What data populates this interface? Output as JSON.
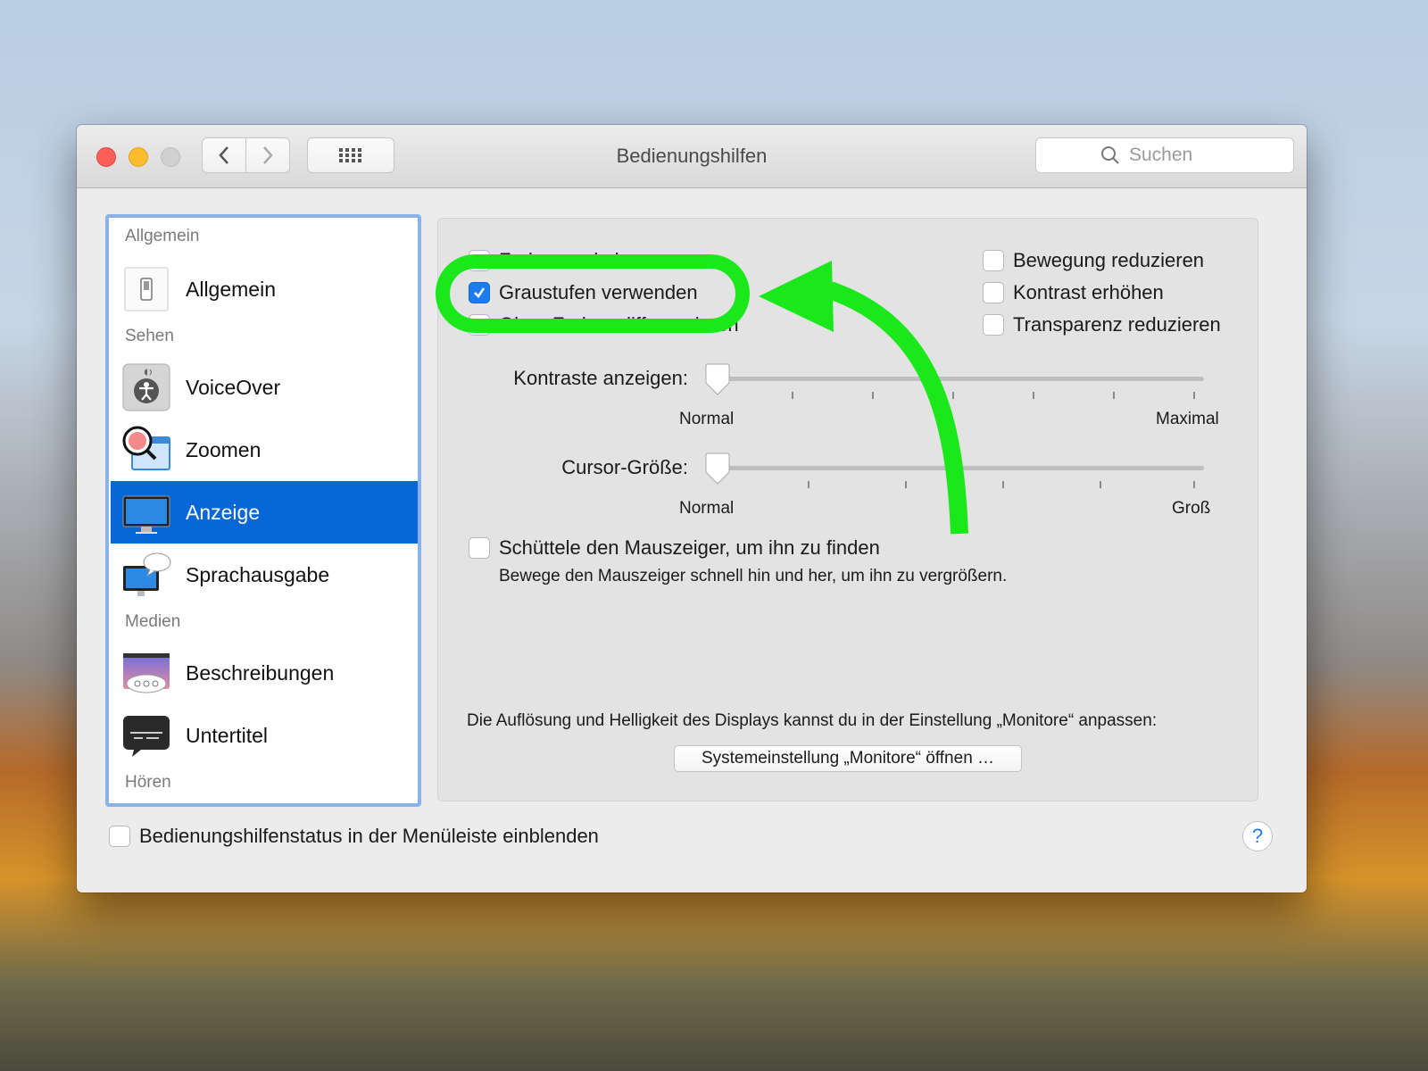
{
  "window": {
    "title": "Bedienungshilfen",
    "search_placeholder": "Suchen"
  },
  "sidebar": {
    "sections": [
      {
        "heading": "Allgemein",
        "items": [
          {
            "label": "Allgemein",
            "icon": "switch-icon"
          }
        ]
      },
      {
        "heading": "Sehen",
        "items": [
          {
            "label": "VoiceOver",
            "icon": "voiceover-icon"
          },
          {
            "label": "Zoomen",
            "icon": "zoom-icon"
          },
          {
            "label": "Anzeige",
            "icon": "display-icon",
            "selected": true
          },
          {
            "label": "Sprachausgabe",
            "icon": "speech-icon"
          }
        ]
      },
      {
        "heading": "Medien",
        "items": [
          {
            "label": "Beschreibungen",
            "icon": "descriptions-icon"
          },
          {
            "label": "Untertitel",
            "icon": "captions-icon"
          }
        ]
      },
      {
        "heading": "Hören",
        "items": []
      }
    ]
  },
  "display": {
    "options_left": [
      {
        "label": "Farben umkehren",
        "checked": false
      },
      {
        "label": "Graustufen verwenden",
        "checked": true
      },
      {
        "label": "Ohne Farben differenzieren",
        "checked": false
      }
    ],
    "options_right": [
      {
        "label": "Bewegung reduzieren",
        "checked": false
      },
      {
        "label": "Kontrast erhöhen",
        "checked": false
      },
      {
        "label": "Transparenz reduzieren",
        "checked": false
      }
    ],
    "contrast_slider": {
      "label": "Kontraste anzeigen:",
      "min_label": "Normal",
      "max_label": "Maximal",
      "value": 0
    },
    "cursor_slider": {
      "label": "Cursor-Größe:",
      "min_label": "Normal",
      "max_label": "Groß",
      "value": 0
    },
    "shake_option": {
      "label": "Schüttele den Mauszeiger, um ihn zu finden",
      "checked": false,
      "description": "Bewege den Mauszeiger schnell hin und her, um ihn zu vergrößern."
    },
    "monitor_note": "Die Auflösung und Helligkeit des Displays kannst du in der Einstellung „Monitore“ anpassen:",
    "monitor_button": "Systemeinstellung „Monitore“ öffnen …"
  },
  "footer": {
    "status_checkbox_label": "Bedienungshilfenstatus in der Menüleiste einblenden",
    "status_checked": false,
    "help_label": "?"
  },
  "annotation": {
    "color": "#1be81b"
  }
}
